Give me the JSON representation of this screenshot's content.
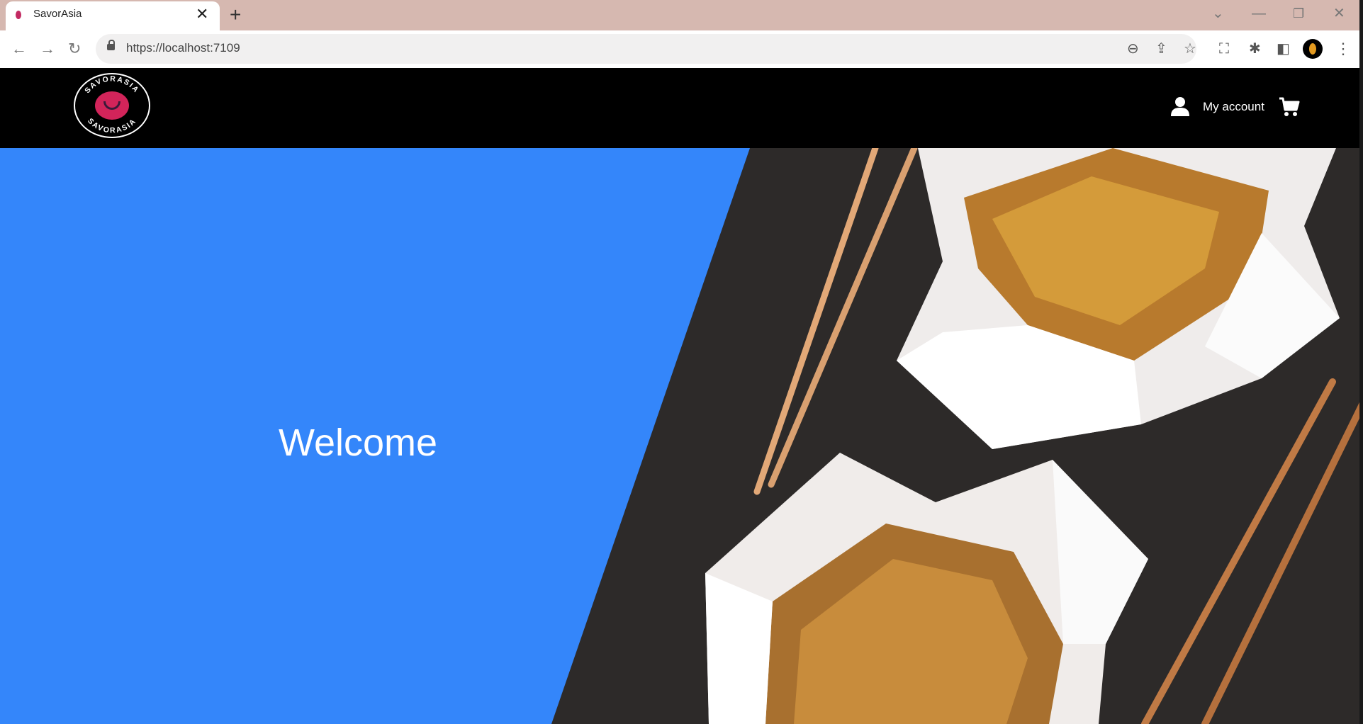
{
  "browser": {
    "tab_title": "SavorAsia",
    "url": "https://localhost:7109"
  },
  "header": {
    "logo_text": "SAVORASIA",
    "account_label": "My account"
  },
  "hero": {
    "welcome_text": "Welcome"
  }
}
